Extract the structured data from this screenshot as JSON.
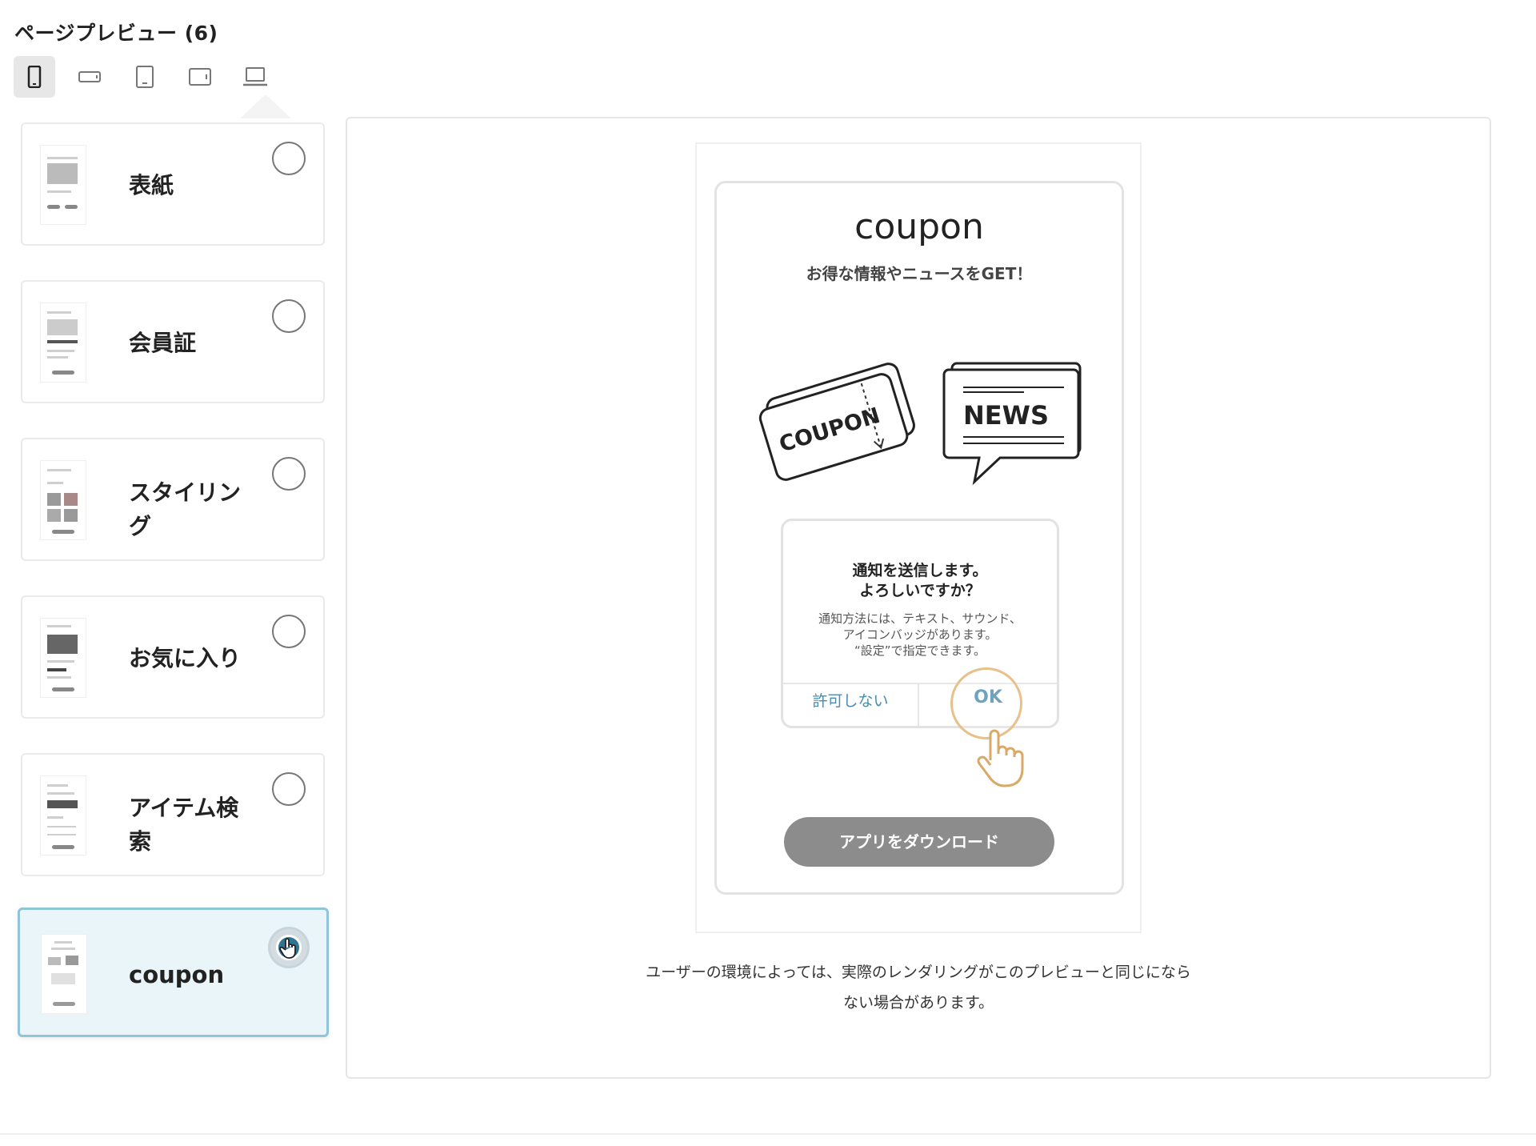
{
  "header": {
    "title": "ページプレビュー (6)"
  },
  "device_tabs": [
    {
      "name": "mobile-portrait",
      "active": true
    },
    {
      "name": "mobile-landscape",
      "active": false
    },
    {
      "name": "tablet-portrait",
      "active": false
    },
    {
      "name": "tablet-landscape",
      "active": false
    },
    {
      "name": "desktop",
      "active": false
    }
  ],
  "pages": [
    {
      "label": "表紙",
      "selected": false
    },
    {
      "label": "会員証",
      "selected": false
    },
    {
      "label": "スタイリング",
      "selected": false
    },
    {
      "label": "お気に入り",
      "selected": false
    },
    {
      "label": "アイテム検索",
      "selected": false
    },
    {
      "label": "coupon",
      "selected": true
    }
  ],
  "preview": {
    "title": "coupon",
    "subtitle": "お得な情報やニュースをGET！",
    "illustration": {
      "coupon_text": "COUPON",
      "news_text": "NEWS"
    },
    "dialog": {
      "title_line1": "通知を送信します。",
      "title_line2": "よろしいですか？",
      "message_line1": "通知方法には、テキスト、サウンド、",
      "message_line2": "アイコンバッジがあります。",
      "message_line3": "“設定”で指定できます。",
      "deny_label": "許可しない",
      "ok_label": "OK"
    },
    "download_button": "アプリをダウンロード"
  },
  "disclaimer": {
    "line1": "ユーザーの環境によっては、実際のレンダリングがこのプレビューと同じになら",
    "line2": "ない場合があります。"
  },
  "colors": {
    "selected_card_bg": "#e9f5f9",
    "selected_card_border": "#8fc4d9",
    "radio_selected": "#2f7490",
    "dialog_link": "#4a8bb0",
    "download_button": "#8c8c8c",
    "tap_ring": "#e7c08a"
  }
}
